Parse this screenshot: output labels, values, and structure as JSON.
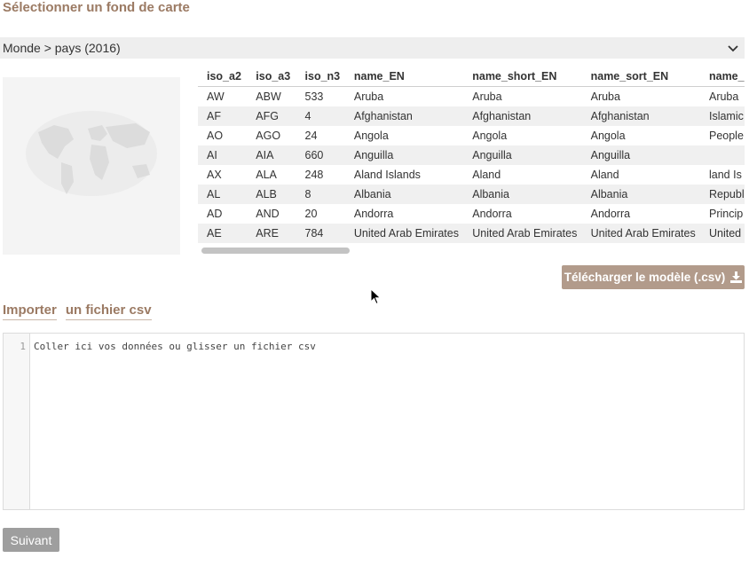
{
  "section_title": "Sélectionner un fond de carte",
  "basemap_select": {
    "value": "Monde > pays (2016)"
  },
  "table": {
    "columns": [
      "iso_a2",
      "iso_a3",
      "iso_n3",
      "name_EN",
      "name_short_EN",
      "name_sort_EN",
      "name_"
    ],
    "rows": [
      [
        "AW",
        "ABW",
        "533",
        "Aruba",
        "Aruba",
        "Aruba",
        "Aruba"
      ],
      [
        "AF",
        "AFG",
        "4",
        "Afghanistan",
        "Afghanistan",
        "Afghanistan",
        "Islamic"
      ],
      [
        "AO",
        "AGO",
        "24",
        "Angola",
        "Angola",
        "Angola",
        "People"
      ],
      [
        "AI",
        "AIA",
        "660",
        "Anguilla",
        "Anguilla",
        "Anguilla",
        ""
      ],
      [
        "AX",
        "ALA",
        "248",
        "Aland Islands",
        "Aland",
        "Aland",
        "land Is"
      ],
      [
        "AL",
        "ALB",
        "8",
        "Albania",
        "Albania",
        "Albania",
        "Republ"
      ],
      [
        "AD",
        "AND",
        "20",
        "Andorra",
        "Andorra",
        "Andorra",
        "Princip"
      ],
      [
        "AE",
        "ARE",
        "784",
        "United Arab Emirates",
        "United Arab Emirates",
        "United Arab Emirates",
        "United"
      ]
    ]
  },
  "download_button": {
    "label": "Télécharger le modèle (.csv)",
    "icon": "download-icon"
  },
  "import_tabs": [
    {
      "label": "Importer"
    },
    {
      "label": "un fichier csv"
    }
  ],
  "editor": {
    "line_number": "1",
    "placeholder": "Coller ici vos données ou glisser un fichier csv"
  },
  "next_button": {
    "label": "Suivant"
  },
  "colors": {
    "accent": "#9b7a63",
    "button_bg": "#b29b8b",
    "next_bg": "#9e9e9e"
  }
}
